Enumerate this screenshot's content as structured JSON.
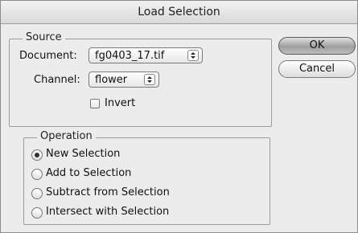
{
  "dialog": {
    "title": "Load Selection"
  },
  "source": {
    "legend": "Source",
    "document_label": "Document:",
    "document_value": "fg0403_17.tif",
    "channel_label": "Channel:",
    "channel_value": "flower",
    "invert_label": "Invert",
    "invert_checked": false
  },
  "operation": {
    "legend": "Operation",
    "options": [
      {
        "label": "New Selection",
        "selected": true
      },
      {
        "label": "Add to Selection",
        "selected": false
      },
      {
        "label": "Subtract from Selection",
        "selected": false
      },
      {
        "label": "Intersect with Selection",
        "selected": false
      }
    ]
  },
  "buttons": {
    "ok": "OK",
    "cancel": "Cancel"
  }
}
